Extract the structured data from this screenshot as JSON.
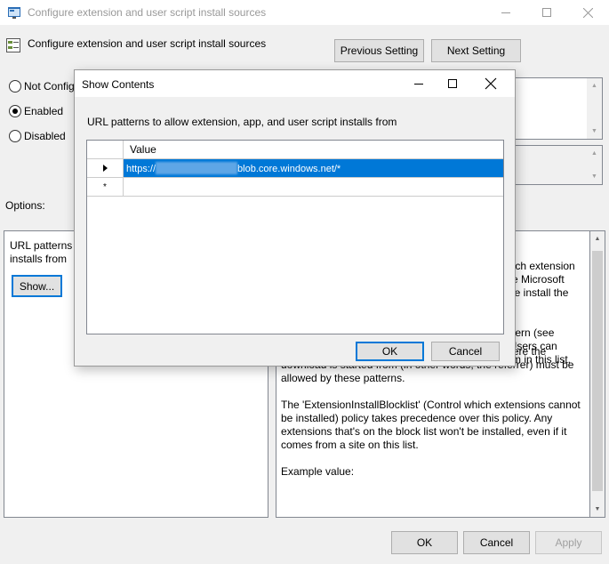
{
  "window": {
    "title": "Configure extension and user script install sources",
    "controls": {
      "minimize": "—",
      "maximize": "☐",
      "close": "✕"
    }
  },
  "header": {
    "title": "Configure extension and user script install sources",
    "prev_label": "Previous Setting",
    "next_label": "Next Setting"
  },
  "state": {
    "options": [
      {
        "label": "Not Configured",
        "checked": false
      },
      {
        "label": "Enabled",
        "checked": true
      },
      {
        "label": "Disabled",
        "checked": false
      }
    ],
    "visible_labels": [
      "Not Config",
      "Enabled",
      "Disabled"
    ]
  },
  "options_panel": {
    "heading": "Options:",
    "label_line1": "URL patterns t",
    "label_line2": "installs from",
    "show_label": "Show..."
  },
  "help": {
    "fragments": [
      "s.",
      "each extension",
      "the Microsoft",
      "use install the",
      "attern (see",
      ". Users can",
      "tem in this list."
    ],
    "paragraphs": [
      "Both the location of the *.crx file and the page where the download is started from (in other words, the referrer) must be allowed by these patterns.",
      "The 'ExtensionInstallBlocklist' (Control which extensions cannot be installed) policy takes precedence over this policy. Any extensions that's on the block list won't be installed, even if it comes from a site on this list.",
      "Example value:"
    ]
  },
  "footer": {
    "ok_label": "OK",
    "cancel_label": "Cancel",
    "apply_label": "Apply"
  },
  "dialog": {
    "title": "Show Contents",
    "description": "URL patterns to allow extension, app, and user script installs from",
    "column_header": "Value",
    "rows": [
      {
        "prefix": "https://",
        "suffix": "blob.core.windows.net/*",
        "selected": true,
        "row_marker": "▶"
      },
      {
        "prefix": "",
        "suffix": "",
        "selected": false,
        "row_marker": "*"
      }
    ],
    "ok_label": "OK",
    "cancel_label": "Cancel"
  },
  "colors": {
    "accent": "#0078d7",
    "window_bg": "#f0f0f0",
    "border": "#828790"
  }
}
